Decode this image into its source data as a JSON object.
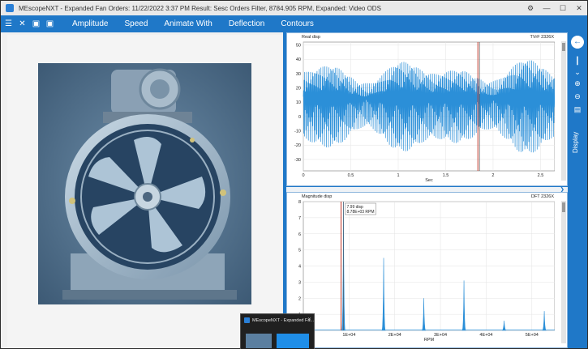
{
  "window": {
    "title": "MEscopeNXT - Expanded Fan Orders: 11/22/2022 3:37 PM  Result: Sesc Orders Filter, 8784.905 RPM, Expanded: Video ODS",
    "controls": [
      "gear-icon",
      "minimize-icon",
      "maximize-icon",
      "close-icon"
    ]
  },
  "menubar": {
    "icons": [
      "hamburger-icon",
      "close-icon",
      "save-icon",
      "save-as-icon"
    ],
    "items": [
      "Amplitude",
      "Speed",
      "Animate With",
      "Deflection",
      "Contours"
    ]
  },
  "right_toolbar": {
    "icons": [
      "back-arrow-icon",
      "slider-icon",
      "chevron-down-icon",
      "zoom-in-icon",
      "zoom-out-icon",
      "report-icon"
    ],
    "display_label": "Display"
  },
  "taskbar_thumbnail": {
    "title": "MEscopeNXT - Expanded Fa..."
  },
  "colors": {
    "accent": "#1f78c8",
    "trace": "#2b8fd8",
    "cursor": "#c0392b"
  },
  "chart_data": [
    {
      "type": "line",
      "title": "Real disp",
      "trace_label": "TVrF 2326X",
      "xlabel": "Sec",
      "ylabel": "",
      "xlim": [
        0,
        2.65
      ],
      "ylim": [
        -38,
        52
      ],
      "x_ticks": [
        "0",
        "0.5",
        "1",
        "1.5",
        "2",
        "2.5"
      ],
      "y_ticks": [
        "50",
        "40",
        "30",
        "20",
        "10",
        "0",
        "-10",
        "-20",
        "-30"
      ],
      "x_tick_values": [
        0,
        0.5,
        1,
        1.5,
        2,
        2.5
      ],
      "y_tick_values": [
        50,
        40,
        30,
        20,
        10,
        0,
        -10,
        -20,
        -30
      ],
      "cursor_x": 1.84,
      "grid": true,
      "series": [
        {
          "signal": "vibration time waveform, dense oscillation approx -30 to 50"
        }
      ]
    },
    {
      "type": "line",
      "title": "Magnitude disp",
      "trace_label": "DFT 2326X",
      "xlabel": "RPM",
      "ylabel": "",
      "xlim": [
        0,
        55000
      ],
      "ylim": [
        0,
        8
      ],
      "x_ticks": [
        "1E+04",
        "2E+04",
        "3E+04",
        "4E+04",
        "5E+04"
      ],
      "y_ticks": [
        "8",
        "7",
        "6",
        "5",
        "4",
        "3",
        "2",
        "1",
        "0"
      ],
      "x_tick_values": [
        10000,
        20000,
        30000,
        40000,
        50000
      ],
      "y_tick_values": [
        8,
        7,
        6,
        5,
        4,
        3,
        2,
        1,
        0
      ],
      "cursor_readout": [
        "7.99 disp",
        "8.78E+03 RPM"
      ],
      "cursor_x": 8784.905,
      "grid": true,
      "peaks": [
        {
          "x": 8785,
          "y": 7.99
        },
        {
          "x": 17570,
          "y": 4.5
        },
        {
          "x": 26355,
          "y": 2.0
        },
        {
          "x": 35140,
          "y": 3.1
        },
        {
          "x": 43925,
          "y": 0.6
        },
        {
          "x": 52710,
          "y": 1.2
        }
      ]
    }
  ]
}
